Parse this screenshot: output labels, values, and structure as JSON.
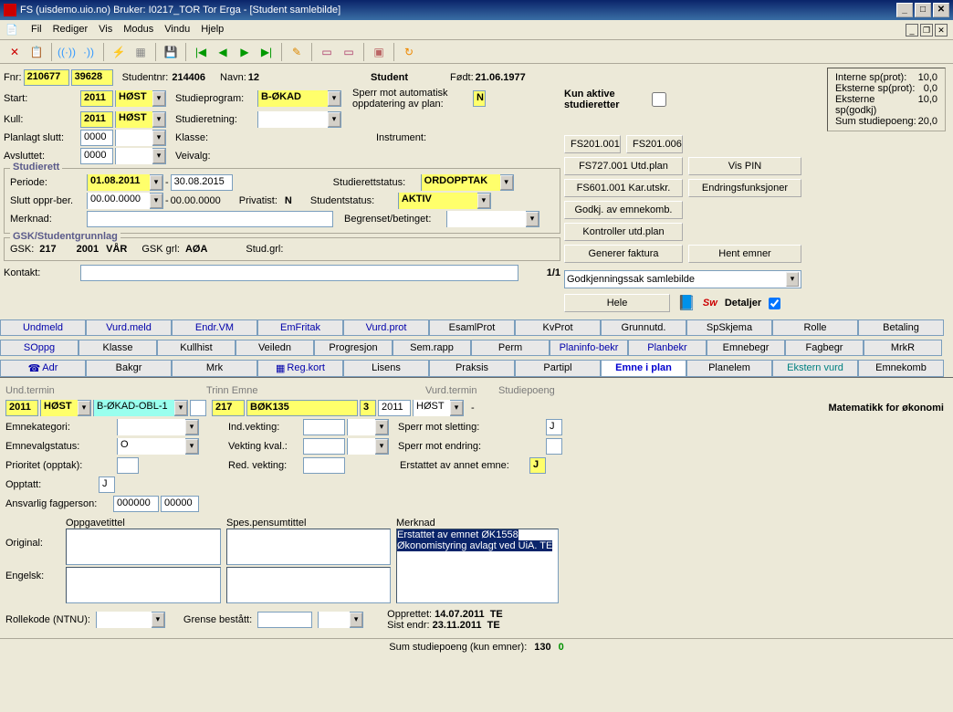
{
  "window": {
    "title": "FS (uisdemo.uio.no) Bruker: I0217_TOR Tor Erga - [Student samlebilde]"
  },
  "menus": [
    "Fil",
    "Rediger",
    "Vis",
    "Modus",
    "Vindu",
    "Hjelp"
  ],
  "student": {
    "fnr_lbl": "Fnr:",
    "fnr1": "210677",
    "fnr2": "39628",
    "studentnr_lbl": "Studentnr:",
    "studentnr": "214406",
    "navn_lbl": "Navn:",
    "navn": "12",
    "type": "Student",
    "fodt_lbl": "Født:",
    "fodt": "21.06.1977",
    "start_lbl": "Start:",
    "start_yr": "2011",
    "start_sem": "HØST",
    "studieprogram_lbl": "Studieprogram:",
    "studieprogram": "B-ØKAD",
    "sperr_auto": "Sperr mot automatisk oppdatering av plan:",
    "sperr_auto_val": "N",
    "kull_lbl": "Kull:",
    "kull_yr": "2011",
    "kull_sem": "HØST",
    "studieretning_lbl": "Studieretning:",
    "planlagt_slutt_lbl": "Planlagt slutt:",
    "planlagt_slutt": "0000",
    "klasse_lbl": "Klasse:",
    "instrument_lbl": "Instrument:",
    "avsluttet_lbl": "Avsluttet:",
    "avsluttet": "0000",
    "veivalg_lbl": "Veivalg:"
  },
  "studierett": {
    "legend": "Studierett",
    "periode_lbl": "Periode:",
    "periode_from": "01.08.2011",
    "periode_to": "30.08.2015",
    "studierettstatus_lbl": "Studierettstatus:",
    "studierettstatus": "ORDOPPTAK",
    "slutt_lbl": "Slutt oppr-ber.",
    "slutt_from": "00.00.0000",
    "slutt_to": "00.00.0000",
    "privatist_lbl": "Privatist:",
    "privatist": "N",
    "studentstatus_lbl": "Studentstatus:",
    "studentstatus": "AKTIV",
    "merknad_lbl": "Merknad:",
    "begrenset_lbl": "Begrenset/betinget:"
  },
  "gsk": {
    "legend": "GSK/Studentgrunnlag",
    "gsk_lbl": "GSK:",
    "gsk_val": "217",
    "yr": "2001",
    "sem": "VÅR",
    "grl_lbl": "GSK grl:",
    "grl_val": "AØA",
    "studgrl_lbl": "Stud.grl:"
  },
  "kontakt_lbl": "Kontakt:",
  "pager": "1/1",
  "right": {
    "kun_aktive": "Kun aktive studieretter",
    "info": {
      "l1": "Interne sp(prot):",
      "v1": "10,0",
      "l2": "Eksterne sp(prot):",
      "v2": "0,0",
      "l3": "Eksterne sp(godkj)",
      "v3": "10,0",
      "l4": "Sum studiepoeng:",
      "v4": "20,0"
    },
    "btns": {
      "b1": "FS201.001",
      "b2": "FS201.006",
      "b3": "FS727.001 Utd.plan",
      "b4": "Vis PIN",
      "b5": "FS601.001 Kar.utskr.",
      "b6": "Endringsfunksjoner",
      "b7": "Godkj. av emnekomb.",
      "b8": "Kontroller utd.plan",
      "b9": "Generer faktura",
      "b10": "Hent emner"
    },
    "goto_option": "Godkjenningssak samlebilde",
    "hele": "Hele",
    "detaljer": "Detaljer"
  },
  "tabs_row1": [
    "Undmeld",
    "Vurd.meld",
    "Endr.VM",
    "EmFritak",
    "Vurd.prot",
    "EsamlProt",
    "KvProt",
    "Grunnutd.",
    "SpSkjema",
    "Rolle",
    "Betaling"
  ],
  "tabs_row2": [
    "SOppg",
    "Klasse",
    "Kullhist",
    "Veiledn",
    "Progresjon",
    "Sem.rapp",
    "Perm",
    "Planinfo-bekr",
    "Planbekr",
    "Emnebegr",
    "Fagbegr",
    "MrkR"
  ],
  "tabs_row3": [
    "Adr",
    "Bakgr",
    "Mrk",
    "Reg.kort",
    "Lisens",
    "Praksis",
    "Partipl",
    "Emne i plan",
    "Planelem",
    "Ekstern vurd",
    "Emnekomb"
  ],
  "tabs_icon1": "☎",
  "tabs_icon2": "▦",
  "cols": {
    "und": "Und.termin",
    "trinn": "Trinn",
    "emne": "Emne",
    "vurd": "Vurd.termin",
    "sp": "Studiepoeng"
  },
  "plan": {
    "yr1": "2011",
    "sem1": "HØST",
    "program": "B-ØKAD-OBL-1",
    "trinn": "",
    "num": "217",
    "emne": "BØK135",
    "v3": "3",
    "yr2": "2011",
    "sem2": "HØST",
    "title": "Matematikk for økonomi",
    "emnekategori_lbl": "Emnekategori:",
    "indvekting_lbl": "Ind.vekting:",
    "sperr_slett_lbl": "Sperr mot sletting:",
    "sperr_slett": "J",
    "emnevalg_lbl": "Emnevalgstatus:",
    "emnevalg": "O",
    "vektingkval_lbl": "Vekting kval.:",
    "sperr_endr_lbl": "Sperr mot endring:",
    "prioritet_lbl": "Prioritet (opptak):",
    "redvekting_lbl": "Red. vekting:",
    "erstattet_lbl": "Erstattet av annet emne:",
    "erstattet": "J",
    "opptatt_lbl": "Opptatt:",
    "opptatt": "J",
    "ansvarlig_lbl": "Ansvarlig fagperson:",
    "ansv1": "000000",
    "ansv2": "00000",
    "oppg_lbl": "Oppgavetittel",
    "spes_lbl": "Spes.pensumtittel",
    "merk_lbl": "Merknad",
    "orig_lbl": "Original:",
    "eng_lbl": "Engelsk:",
    "merknad_text": "Erstattet av emnet ØK1558 Økonomistyring avlagt ved UiA. TE",
    "opprettet_lbl": "Opprettet:",
    "opprettet": "14.07.2011",
    "oppr_by": "TE",
    "sist_lbl": "Sist endr:",
    "sist": "23.11.2011",
    "sist_by": "TE",
    "rolle_lbl": "Rollekode (NTNU):",
    "grense_lbl": "Grense bestått:"
  },
  "status": {
    "lbl": "Sum studiepoeng (kun emner):",
    "v1": "130",
    "v2": "0"
  }
}
